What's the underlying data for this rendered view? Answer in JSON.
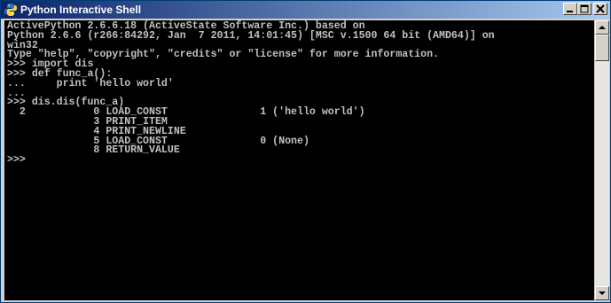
{
  "window": {
    "title": "Python Interactive Shell",
    "icon": "python-icon"
  },
  "controls": {
    "minimize": "minimize-icon",
    "maximize": "maximize-icon",
    "close": "close-icon"
  },
  "console": {
    "lines": [
      "ActivePython 2.6.6.18 (ActiveState Software Inc.) based on",
      "Python 2.6.6 (r266:84292, Jan  7 2011, 14:01:45) [MSC v.1500 64 bit (AMD64)] on",
      "win32",
      "Type \"help\", \"copyright\", \"credits\" or \"license\" for more information.",
      ">>> import dis",
      ">>> def func_a():",
      "...     print 'hello world'",
      "...",
      ">>> dis.dis(func_a)",
      "  2           0 LOAD_CONST               1 ('hello world')",
      "              3 PRINT_ITEM",
      "              4 PRINT_NEWLINE",
      "              5 LOAD_CONST               0 (None)",
      "              8 RETURN_VALUE",
      ">>>"
    ]
  },
  "colors": {
    "console_bg": "#000000",
    "console_fg": "#c0c0c0",
    "titlebar_start": "#0a246a",
    "titlebar_end": "#a6caf0"
  }
}
